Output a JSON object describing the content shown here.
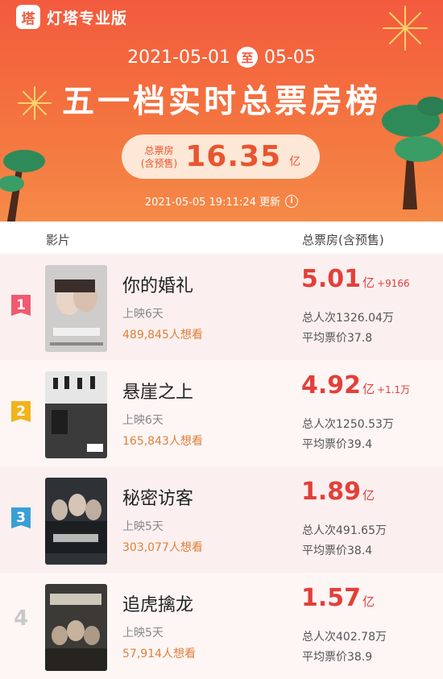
{
  "header": {
    "brand": "灯塔专业版",
    "brand_logo": "塔",
    "date_start": "2021-05-01",
    "date_to": "至",
    "date_end": "05-05",
    "title": "五一档实时总票房榜",
    "total_label_line1": "总票房",
    "total_label_line2": "(含预售)",
    "total_value": "16.35",
    "total_unit": "亿",
    "update_text": "2021-05-05 19:11:24 更新",
    "info_icon": "i"
  },
  "columns": {
    "film": "影片",
    "box_office": "总票房(含预售)"
  },
  "colors": {
    "banner": "#f35a3e",
    "pill": "#fde7d6",
    "box_value": "#e33f3a",
    "want": "#e0803a",
    "rank1": "#ef5a70",
    "rank2": "#f2b31b",
    "rank3": "#3a9fd6"
  },
  "movies": [
    {
      "rank": "1",
      "title": "你的婚礼",
      "days": "上映6天",
      "want": "489,845人想看",
      "box_value": "5.01",
      "box_unit": "亿",
      "box_delta": "+9166",
      "viewers": "总人次1326.04万",
      "avg_price": "平均票价37.8"
    },
    {
      "rank": "2",
      "title": "悬崖之上",
      "days": "上映6天",
      "want": "165,843人想看",
      "box_value": "4.92",
      "box_unit": "亿",
      "box_delta": "+1.1万",
      "viewers": "总人次1250.53万",
      "avg_price": "平均票价39.4"
    },
    {
      "rank": "3",
      "title": "秘密访客",
      "days": "上映5天",
      "want": "303,077人想看",
      "box_value": "1.89",
      "box_unit": "亿",
      "box_delta": "",
      "viewers": "总人次491.65万",
      "avg_price": "平均票价38.4"
    },
    {
      "rank": "4",
      "title": "追虎擒龙",
      "days": "上映5天",
      "want": "57,914人想看",
      "box_value": "1.57",
      "box_unit": "亿",
      "box_delta": "",
      "viewers": "总人次402.78万",
      "avg_price": "平均票价38.9"
    }
  ]
}
